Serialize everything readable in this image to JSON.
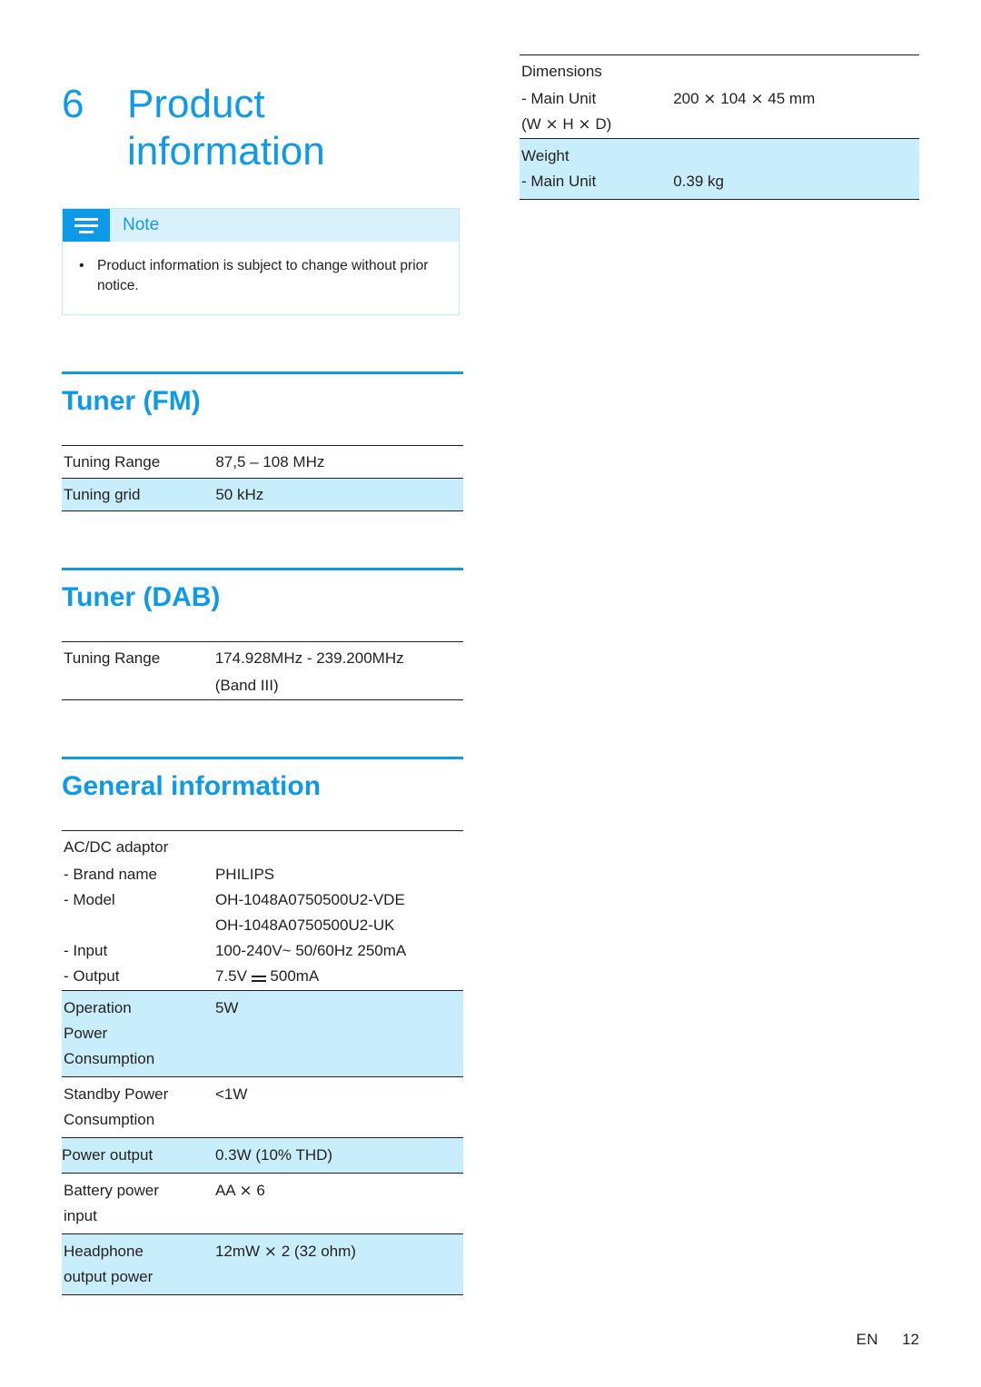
{
  "chapter": {
    "number": "6",
    "title": "Product information"
  },
  "note": {
    "label": "Note",
    "bullet": "•",
    "text": "Product information is subject to change without prior notice."
  },
  "sections": {
    "tuner_fm": {
      "heading": "Tuner (FM)",
      "rows": [
        {
          "key": "Tuning Range",
          "value": "87,5 – 108 MHz",
          "highlight": false
        },
        {
          "key": "Tuning grid",
          "value": "50 kHz",
          "highlight": true
        }
      ]
    },
    "tuner_dab": {
      "heading": "Tuner (DAB)",
      "rows": [
        {
          "key": "Tuning Range",
          "value": "174.928MHz - 239.200MHz",
          "value2": "(Band III)",
          "highlight": false
        }
      ]
    },
    "general": {
      "heading": "General information",
      "rows": [
        {
          "key": "AC/DC adaptor",
          "value": "",
          "highlight": false
        },
        {
          "key": "- Brand name",
          "value": "PHILIPS",
          "highlight": false
        },
        {
          "key": "- Model",
          "value": "OH-1048A0750500U2-VDE",
          "value2": "OH-1048A0750500U2-UK",
          "highlight": false
        },
        {
          "key": "- Input",
          "value": "100-240V~ 50/60Hz 250mA",
          "highlight": false
        },
        {
          "key": "- Output",
          "value": "7.5V ⎓ 500mA",
          "highlight": false
        },
        {
          "key": "Operation Power Consumption",
          "value": "5W",
          "highlight": true
        },
        {
          "key": "Standby Power Consumption",
          "value": "<1W",
          "highlight": false
        },
        {
          "key": "Power output",
          "value": "0.3W (10% THD)",
          "highlight": true
        },
        {
          "key": "Battery power input",
          "value": "AA ⨯ 6",
          "highlight": false
        },
        {
          "key": "Headphone output power",
          "value": "12mW ⨯ 2 (32 ohm)",
          "highlight": true
        }
      ]
    },
    "dimensions": {
      "rows": [
        {
          "key": "Dimensions",
          "value": "",
          "highlight": false
        },
        {
          "key": "- Main Unit",
          "value": "200 ⨯ 104 ⨯ 45 mm",
          "highlight": false
        },
        {
          "key": "(W ⨯ H ⨯ D)",
          "value": "",
          "highlight": false
        },
        {
          "key": "Weight",
          "value": "",
          "highlight": true
        },
        {
          "key": "- Main Unit",
          "value": "0.39 kg",
          "highlight": true
        }
      ]
    }
  },
  "labels": {
    "operation_l1": "Operation",
    "operation_l2": "Power",
    "operation_l3": "Consumption",
    "standby_l1": "Standby Power",
    "standby_l2": "Consumption",
    "battery_l1": "Battery power",
    "battery_l2": "input",
    "headphone_l1": "Headphone",
    "headphone_l2": "output power",
    "output_voltage_pre": "7.5V",
    "output_voltage_post": "500mA"
  },
  "footer": {
    "lang": "EN",
    "page": "12"
  },
  "colors": {
    "accent": "#0d9ae8",
    "highlight": "#c9eefb",
    "text": "#231f20"
  }
}
